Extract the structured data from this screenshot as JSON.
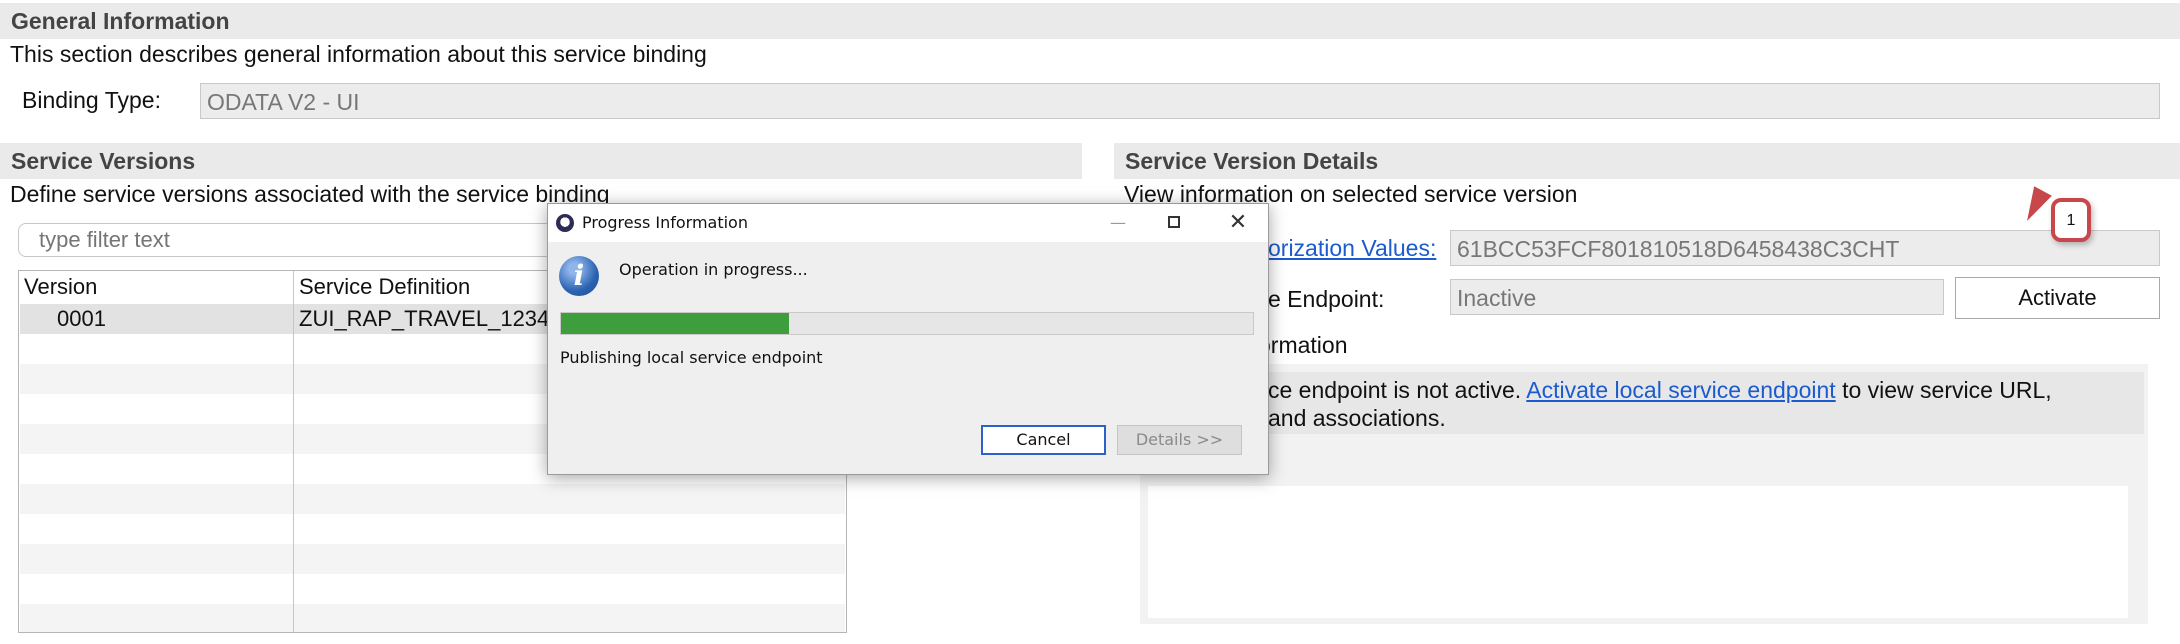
{
  "general": {
    "header": "General Information",
    "description": "This section describes general information about this service binding",
    "binding_type_label": "Binding Type:",
    "binding_type_value": "ODATA V2 - UI"
  },
  "versions": {
    "header": "Service Versions",
    "description": "Define service versions associated with the service binding",
    "filter_placeholder": "type filter text",
    "columns": [
      "Version",
      "Service Definition"
    ],
    "rows": [
      {
        "version": "0001",
        "definition": "ZUI_RAP_TRAVEL_1234"
      }
    ]
  },
  "details": {
    "header": "Service Version Details",
    "description": "View information on selected service version",
    "auth_label": "orization Values:",
    "auth_value": "61BCC53FCF801810518D6458438C3CHT",
    "endpoint_label": "e Endpoint:",
    "endpoint_value": "Inactive",
    "activate_label": "Activate",
    "info_header": "ormation",
    "info_text_pre": "ce endpoint is not active.",
    "info_link": "Activate local service endpoint",
    "info_text_post": "to view service URL,",
    "info_text_line2": "and associations."
  },
  "dialog": {
    "title": "Progress Information",
    "message": "Operation in progress...",
    "progress": 0.33,
    "status": "Publishing local service endpoint",
    "cancel_label": "Cancel",
    "details_label": "Details >>",
    "progress_color": "#3e9e3e",
    "info_icon_color": "#2b63b3"
  },
  "callout": {
    "number": "1",
    "border_color": "#c7474a"
  }
}
